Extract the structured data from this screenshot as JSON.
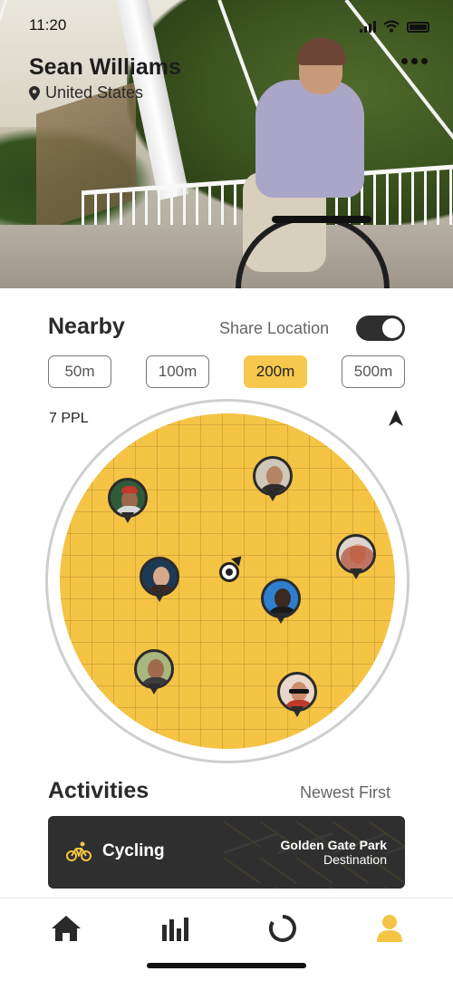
{
  "status_bar": {
    "time": "11:20"
  },
  "profile": {
    "name": "Sean Williams",
    "location": "United States"
  },
  "nearby": {
    "title": "Nearby",
    "share_location_label": "Share Location",
    "share_location_on": true,
    "distances": [
      "50m",
      "100m",
      "200m",
      "500m"
    ],
    "selected_distance": "200m",
    "people_count": "7 PPL"
  },
  "activities": {
    "title": "Activities",
    "sort_label": "Newest First",
    "items": [
      {
        "name": "Cycling",
        "place": "Golden Gate Park",
        "place_role": "Destination",
        "icon": "bicycle-icon"
      }
    ]
  },
  "tabs": [
    {
      "name": "home",
      "icon": "home-icon"
    },
    {
      "name": "stats",
      "icon": "bar-chart-icon"
    },
    {
      "name": "activity",
      "icon": "ring-icon"
    },
    {
      "name": "profile",
      "icon": "user-icon",
      "active": true
    }
  ],
  "colors": {
    "accent": "#f5c445",
    "dark": "#2f2f2f",
    "muted": "#666666"
  }
}
